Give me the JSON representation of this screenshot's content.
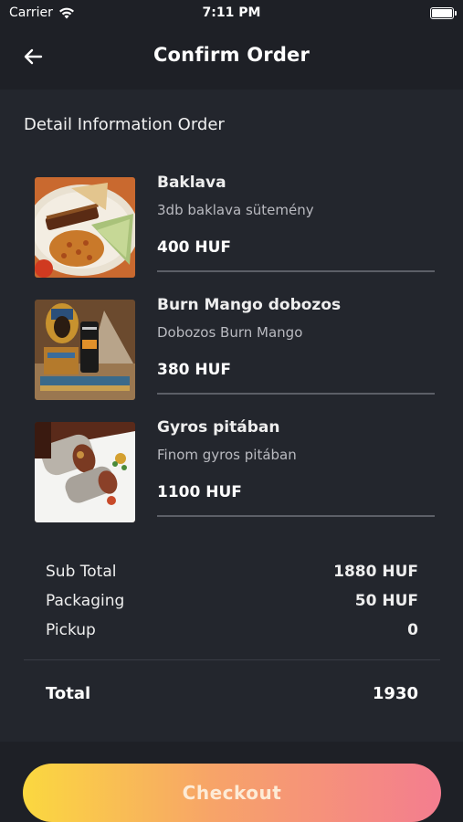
{
  "status_bar": {
    "carrier": "Carrier",
    "time": "7:11 PM"
  },
  "header": {
    "title": "Confirm Order"
  },
  "section": {
    "title": "Detail Information Order"
  },
  "items": [
    {
      "name": "Baklava",
      "description": "3db baklava sütemény",
      "price": "400 HUF"
    },
    {
      "name": "Burn Mango dobozos",
      "description": "Dobozos Burn Mango",
      "price": "380 HUF"
    },
    {
      "name": "Gyros pitában",
      "description": "Finom gyros pitában",
      "price": "1100 HUF"
    }
  ],
  "summary": {
    "subtotal_label": "Sub Total",
    "subtotal_value": "1880 HUF",
    "packaging_label": "Packaging",
    "packaging_value": "50 HUF",
    "pickup_label": "Pickup",
    "pickup_value": "0",
    "total_label": "Total",
    "total_value": "1930"
  },
  "checkout": {
    "label": "Checkout"
  },
  "colors": {
    "background": "#23262d",
    "header": "#1e2026",
    "gradient_start": "#fbd83f",
    "gradient_end": "#f47d8f"
  },
  "icons": [
    "wifi-icon",
    "battery-icon",
    "back-arrow-icon"
  ]
}
